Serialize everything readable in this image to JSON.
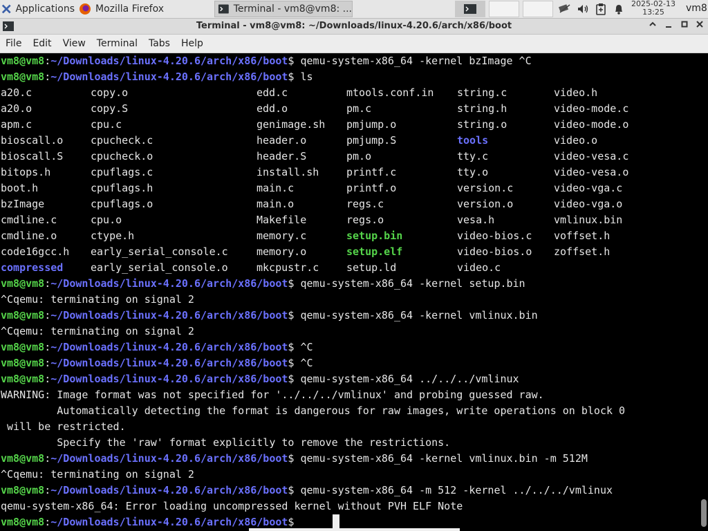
{
  "panel": {
    "applications_label": "Applications",
    "tasks": [
      {
        "label": "Mozilla Firefox"
      },
      {
        "label": "Terminal - vm8@vm8: ..."
      }
    ],
    "clock_date": "2025-02-13",
    "clock_time": "13:25",
    "user": "vm8"
  },
  "window": {
    "title": "Terminal - vm8@vm8: ~/Downloads/linux-4.20.6/arch/x86/boot"
  },
  "menubar": {
    "items": [
      "File",
      "Edit",
      "View",
      "Terminal",
      "Tabs",
      "Help"
    ]
  },
  "terminal": {
    "prompt_user": "vm8@vm8",
    "prompt_path": "~/Downloads/linux-4.20.6/arch/x86/boot",
    "cmd1": "qemu-system-x86_64 -kernel bzImage ^C",
    "cmd2": "ls",
    "ls_columns": [
      [
        {
          "name": "a20.c"
        },
        {
          "name": "a20.o"
        },
        {
          "name": "apm.c"
        },
        {
          "name": "bioscall.o"
        },
        {
          "name": "bioscall.S"
        },
        {
          "name": "bitops.h"
        },
        {
          "name": "boot.h"
        },
        {
          "name": "bzImage"
        },
        {
          "name": "cmdline.c"
        },
        {
          "name": "cmdline.o"
        },
        {
          "name": "code16gcc.h"
        },
        {
          "name": "compressed",
          "type": "dir"
        }
      ],
      [
        {
          "name": "copy.o"
        },
        {
          "name": "copy.S"
        },
        {
          "name": "cpu.c"
        },
        {
          "name": "cpucheck.c"
        },
        {
          "name": "cpucheck.o"
        },
        {
          "name": "cpuflags.c"
        },
        {
          "name": "cpuflags.h"
        },
        {
          "name": "cpuflags.o"
        },
        {
          "name": "cpu.o"
        },
        {
          "name": "ctype.h"
        },
        {
          "name": "early_serial_console.c"
        },
        {
          "name": "early_serial_console.o"
        }
      ],
      [
        {
          "name": "edd.c"
        },
        {
          "name": "edd.o"
        },
        {
          "name": "genimage.sh"
        },
        {
          "name": "header.o"
        },
        {
          "name": "header.S"
        },
        {
          "name": "install.sh"
        },
        {
          "name": "main.c"
        },
        {
          "name": "main.o"
        },
        {
          "name": "Makefile"
        },
        {
          "name": "memory.c"
        },
        {
          "name": "memory.o"
        },
        {
          "name": "mkcpustr.c"
        }
      ],
      [
        {
          "name": "mtools.conf.in"
        },
        {
          "name": "pm.c"
        },
        {
          "name": "pmjump.o"
        },
        {
          "name": "pmjump.S"
        },
        {
          "name": "pm.o"
        },
        {
          "name": "printf.c"
        },
        {
          "name": "printf.o"
        },
        {
          "name": "regs.c"
        },
        {
          "name": "regs.o"
        },
        {
          "name": "setup.bin",
          "type": "exe"
        },
        {
          "name": "setup.elf",
          "type": "exe"
        },
        {
          "name": "setup.ld"
        }
      ],
      [
        {
          "name": "string.c"
        },
        {
          "name": "string.h"
        },
        {
          "name": "string.o"
        },
        {
          "name": "tools",
          "type": "dir"
        },
        {
          "name": "tty.c"
        },
        {
          "name": "tty.o"
        },
        {
          "name": "version.c"
        },
        {
          "name": "version.o"
        },
        {
          "name": "vesa.h"
        },
        {
          "name": "video-bios.c"
        },
        {
          "name": "video-bios.o"
        },
        {
          "name": "video.c"
        }
      ],
      [
        {
          "name": "video.h"
        },
        {
          "name": "video-mode.c"
        },
        {
          "name": "video-mode.o"
        },
        {
          "name": "video.o"
        },
        {
          "name": "video-vesa.c"
        },
        {
          "name": "video-vesa.o"
        },
        {
          "name": "video-vga.c"
        },
        {
          "name": "video-vga.o"
        },
        {
          "name": "vmlinux.bin"
        },
        {
          "name": "voffset.h"
        },
        {
          "name": "zoffset.h"
        }
      ]
    ],
    "cmd3": "qemu-system-x86_64 -kernel setup.bin",
    "out3": "^Cqemu: terminating on signal 2",
    "cmd4": "qemu-system-x86_64 -kernel vmlinux.bin",
    "out4": "^Cqemu: terminating on signal 2",
    "cmd5": "^C",
    "cmd6": "^C",
    "cmd7": "qemu-system-x86_64 ../../../vmlinux",
    "warn1": "WARNING: Image format was not specified for '../../../vmlinux' and probing guessed raw.",
    "warn2": "         Automatically detecting the format is dangerous for raw images, write operations on block 0",
    "warn3": " will be restricted.",
    "warn4": "         Specify the 'raw' format explicitly to remove the restrictions.",
    "cmd8": "qemu-system-x86_64 -kernel vmlinux.bin -m 512M",
    "out8": "^Cqemu: terminating on signal 2",
    "cmd9": "qemu-system-x86_64 -m 512 -kernel ../../../vmlinux",
    "out9": "qemu-system-x86_64: Error loading uncompressed kernel without PVH ELF Note",
    "cmd10": ""
  }
}
